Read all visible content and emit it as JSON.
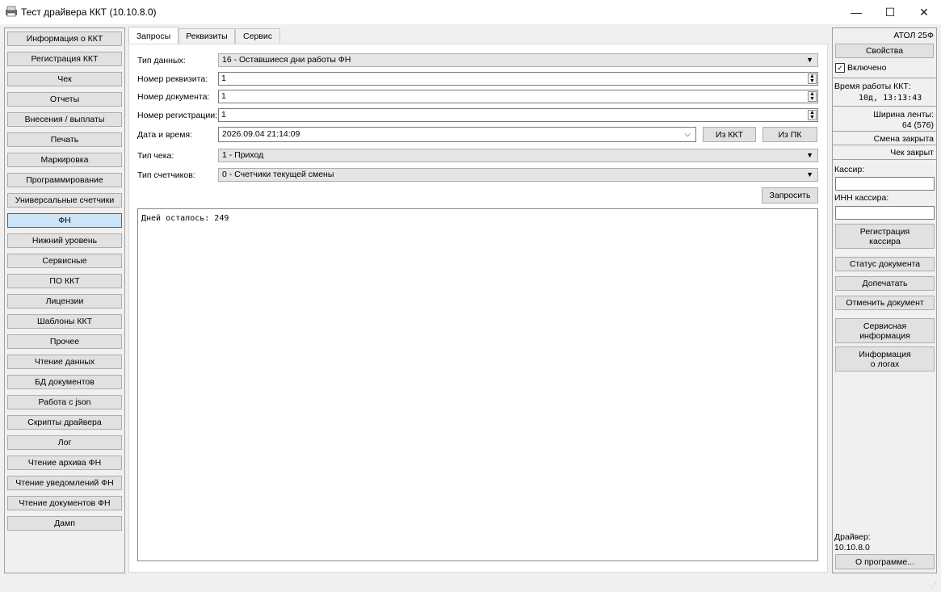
{
  "window": {
    "title": "Тест драйвера ККТ (10.10.8.0)",
    "minimize": "—",
    "maximize": "☐",
    "close": "✕"
  },
  "sidebar": {
    "items": [
      {
        "label": "Информация о ККТ"
      },
      {
        "label": "Регистрация ККТ"
      },
      {
        "label": "Чек"
      },
      {
        "label": "Отчеты"
      },
      {
        "label": "Внесения / выплаты"
      },
      {
        "label": "Печать"
      },
      {
        "label": "Маркировка"
      },
      {
        "label": "Программирование"
      },
      {
        "label": "Универсальные счетчики"
      },
      {
        "label": "ФН",
        "active": true
      },
      {
        "label": "Нижний уровень"
      },
      {
        "label": "Сервисные"
      },
      {
        "label": "ПО ККТ"
      },
      {
        "label": "Лицензии"
      },
      {
        "label": "Шаблоны ККТ"
      },
      {
        "label": "Прочее"
      },
      {
        "label": "Чтение данных"
      },
      {
        "label": "БД документов"
      },
      {
        "label": "Работа с json"
      },
      {
        "label": "Скрипты драйвера"
      },
      {
        "label": "Лог"
      },
      {
        "label": "Чтение архива ФН"
      },
      {
        "label": "Чтение уведомлений ФН"
      },
      {
        "label": "Чтение документов ФН"
      },
      {
        "label": "Дамп"
      }
    ]
  },
  "tabs": [
    {
      "label": "Запросы",
      "active": true
    },
    {
      "label": "Реквизиты"
    },
    {
      "label": "Сервис"
    }
  ],
  "form": {
    "data_type_label": "Тип данных:",
    "data_type_value": "16 - Оставшиеся дни работы ФН",
    "requisite_label": "Номер реквизита:",
    "requisite_value": "1",
    "document_label": "Номер документа:",
    "document_value": "1",
    "registration_label": "Номер регистрации:",
    "registration_value": "1",
    "datetime_label": "Дата и время:",
    "datetime_value": "2026.09.04 21:14:09",
    "from_kkt": "Из ККТ",
    "from_pc": "Из ПК",
    "receipt_type_label": "Тип чека:",
    "receipt_type_value": "1 - Приход",
    "counters_type_label": "Тип счетчиков:",
    "counters_type_value": "0 - Счетчики текущей смены",
    "request_button": "Запросить",
    "output": "Дней осталось: 249"
  },
  "right": {
    "model": "АТОЛ 25Ф",
    "properties": "Свойства",
    "enabled_label": "Включено",
    "enabled_checked": true,
    "uptime_label": "Время работы ККТ:",
    "uptime_value": "10д, 13:13:43",
    "tape_width_label": "Ширина ленты:",
    "tape_width_value": "64 (576)",
    "shift_status": "Смена закрыта",
    "receipt_status": "Чек закрыт",
    "cashier_label": "Кассир:",
    "cashier_value": "",
    "cashier_inn_label": "ИНН кассира:",
    "cashier_inn_value": "",
    "register_cashier_1": "Регистрация",
    "register_cashier_2": "кассира",
    "document_status": "Статус документа",
    "reprint": "Допечатать",
    "cancel_document": "Отменить документ",
    "service_info_1": "Сервисная",
    "service_info_2": "информация",
    "log_info_1": "Информация",
    "log_info_2": "о логах",
    "driver_label": "Драйвер:",
    "driver_version": "10.10.8.0",
    "about": "О программе..."
  }
}
